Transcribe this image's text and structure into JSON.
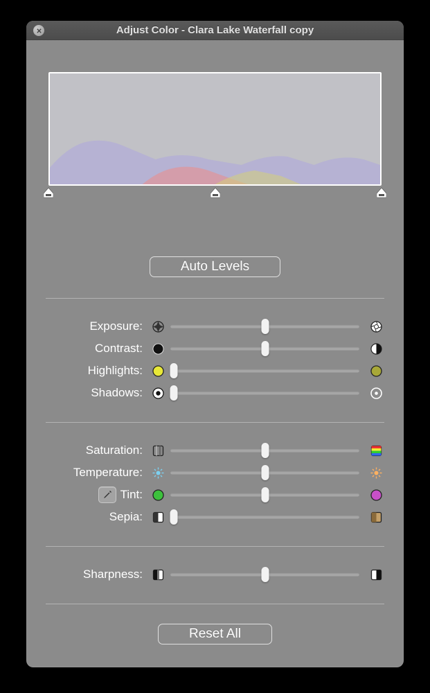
{
  "window": {
    "title": "Adjust Color - Clara Lake Waterfall copy"
  },
  "buttons": {
    "auto_levels": "Auto Levels",
    "reset_all": "Reset All"
  },
  "histogram": {
    "handles": [
      {
        "pos": 0
      },
      {
        "pos": 50
      },
      {
        "pos": 100
      }
    ]
  },
  "sections": [
    {
      "key": "tone",
      "rows": [
        {
          "key": "exposure",
          "label": "Exposure:",
          "value": 50,
          "leftIcon": "aperture-closed-icon",
          "rightIcon": "aperture-open-icon"
        },
        {
          "key": "contrast",
          "label": "Contrast:",
          "value": 50,
          "leftIcon": "circle-black-icon",
          "rightIcon": "circle-half-icon"
        },
        {
          "key": "highlights",
          "label": "Highlights:",
          "value": 2,
          "leftIcon": "circle-yellow-icon",
          "rightIcon": "circle-olive-icon"
        },
        {
          "key": "shadows",
          "label": "Shadows:",
          "value": 2,
          "leftIcon": "circle-dot-black-icon",
          "rightIcon": "circle-dot-white-icon"
        }
      ]
    },
    {
      "key": "color",
      "rows": [
        {
          "key": "saturation",
          "label": "Saturation:",
          "value": 50,
          "leftIcon": "square-gray-icon",
          "rightIcon": "square-rainbow-icon"
        },
        {
          "key": "temperature",
          "label": "Temperature:",
          "value": 50,
          "leftIcon": "sun-cool-icon",
          "rightIcon": "sun-warm-icon"
        },
        {
          "key": "tint",
          "label": "Tint:",
          "value": 50,
          "leftIcon": "circle-green-icon",
          "rightIcon": "circle-magenta-icon",
          "eyedropper": true
        },
        {
          "key": "sepia",
          "label": "Sepia:",
          "value": 2,
          "leftIcon": "square-bw-icon",
          "rightIcon": "square-sepia-icon"
        }
      ]
    },
    {
      "key": "sharp",
      "rows": [
        {
          "key": "sharpness",
          "label": "Sharpness:",
          "value": 50,
          "leftIcon": "square-soft-icon",
          "rightIcon": "square-sharp-icon"
        }
      ]
    }
  ]
}
